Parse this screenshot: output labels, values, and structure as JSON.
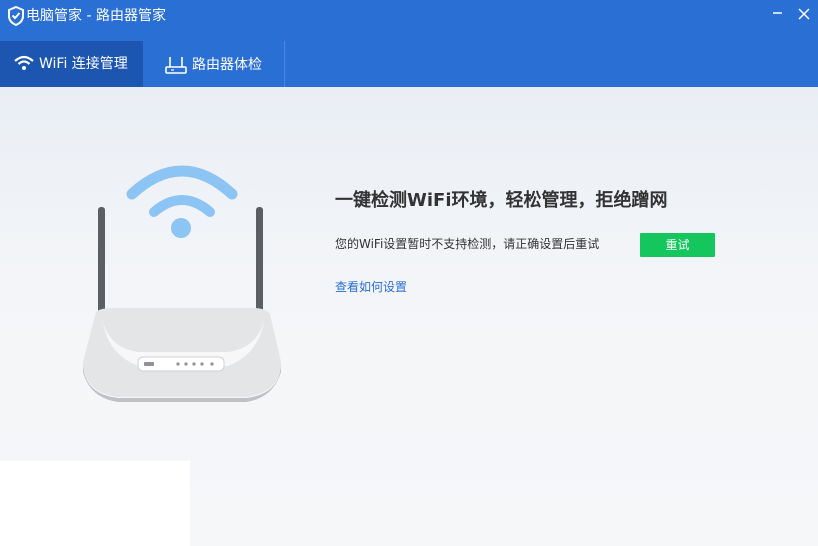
{
  "window": {
    "title": "电脑管家 - 路由器管家",
    "logo_icon": "shield-icon",
    "minimize_icon": "minimize-icon",
    "close_icon": "close-icon"
  },
  "tabs": [
    {
      "label": "WiFi 连接管理",
      "icon": "wifi-icon",
      "active": true
    },
    {
      "label": "路由器体检",
      "icon": "router-icon",
      "active": false
    }
  ],
  "main": {
    "headline": "一键检测WiFi环境，轻松管理，拒绝蹭网",
    "status_text": "您的WiFi设置暂时不支持检测，请正确设置后重试",
    "retry_label": "重试",
    "help_link": "查看如何设置",
    "illustration_icon": "wifi-router-illustration"
  },
  "colors": {
    "titlebar": "#2a6fd3",
    "active_tab": "#1c56b0",
    "retry_button": "#15c55e",
    "link": "#2a6fd3",
    "wifi_signal": "#8cc4f4"
  }
}
